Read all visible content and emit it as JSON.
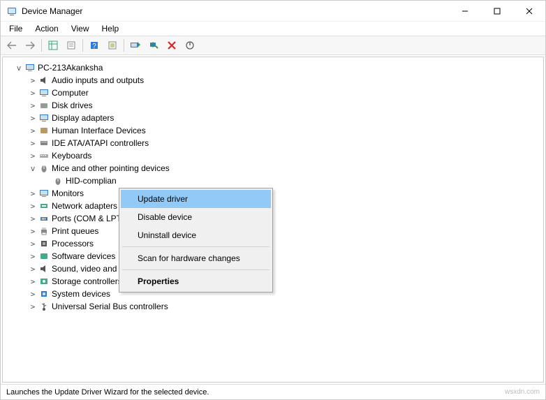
{
  "window": {
    "title": "Device Manager"
  },
  "menubar": {
    "items": [
      "File",
      "Action",
      "View",
      "Help"
    ]
  },
  "tree": {
    "root": "PC-213Akanksha",
    "nodes": [
      {
        "label": "Audio inputs and outputs",
        "icon": "speaker-icon"
      },
      {
        "label": "Computer",
        "icon": "monitor-icon"
      },
      {
        "label": "Disk drives",
        "icon": "disk-icon"
      },
      {
        "label": "Display adapters",
        "icon": "monitor-icon"
      },
      {
        "label": "Human Interface Devices",
        "icon": "hid-icon"
      },
      {
        "label": "IDE ATA/ATAPI controllers",
        "icon": "ata-icon"
      },
      {
        "label": "Keyboards",
        "icon": "keyboard-icon"
      },
      {
        "label": "Mice and other pointing devices",
        "icon": "mouse-icon",
        "expanded": true,
        "children": [
          {
            "label": "HID-complian",
            "icon": "mouse-icon"
          }
        ]
      },
      {
        "label": "Monitors",
        "icon": "monitor-icon"
      },
      {
        "label": "Network adapters",
        "icon": "network-icon"
      },
      {
        "label": "Ports (COM & LPT",
        "icon": "port-icon"
      },
      {
        "label": "Print queues",
        "icon": "printer-icon"
      },
      {
        "label": "Processors",
        "icon": "cpu-icon"
      },
      {
        "label": "Software devices",
        "icon": "software-icon"
      },
      {
        "label": "Sound, video and g",
        "icon": "speaker-icon",
        "truncated": true
      },
      {
        "label": "Storage controllers",
        "icon": "storage-icon"
      },
      {
        "label": "System devices",
        "icon": "chip-icon"
      },
      {
        "label": "Universal Serial Bus controllers",
        "icon": "usb-icon"
      }
    ]
  },
  "context_menu": {
    "items": [
      {
        "label": "Update driver",
        "highlight": true
      },
      {
        "label": "Disable device"
      },
      {
        "label": "Uninstall device"
      },
      {
        "sep": true
      },
      {
        "label": "Scan for hardware changes"
      },
      {
        "sep": true
      },
      {
        "label": "Properties",
        "bold": true
      }
    ]
  },
  "status": {
    "text": "Launches the Update Driver Wizard for the selected device."
  },
  "watermark": "wsxdn.com"
}
